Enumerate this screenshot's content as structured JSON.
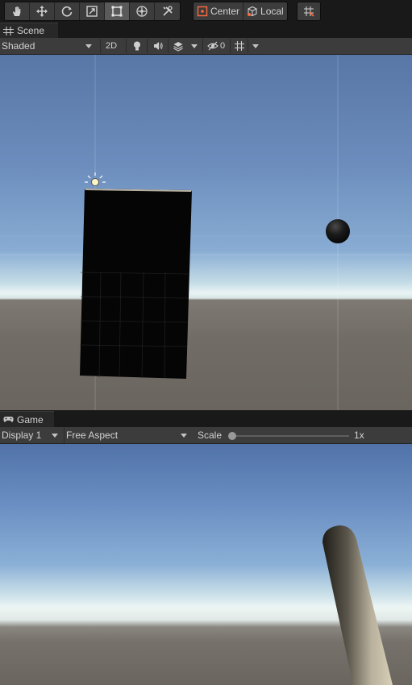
{
  "toolbar": {
    "tools": [
      {
        "name": "hand-tool",
        "icon": "hand-icon",
        "active": false
      },
      {
        "name": "move-tool",
        "icon": "move-icon",
        "active": false
      },
      {
        "name": "rotate-tool",
        "icon": "rotate-icon",
        "active": false
      },
      {
        "name": "scale-tool",
        "icon": "scale-icon",
        "active": false
      },
      {
        "name": "rect-tool",
        "icon": "rect-icon",
        "active": true
      },
      {
        "name": "transform-tool",
        "icon": "transform-icon",
        "active": false
      },
      {
        "name": "custom-tool",
        "icon": "tools-icon",
        "active": false
      }
    ],
    "pivot_label": "Center",
    "rotation_label": "Local",
    "snap_icon": "grid-snap-icon"
  },
  "scene": {
    "tab_label": "Scene",
    "draw_mode": "Shaded",
    "mode_2d_label": "2D",
    "hidden_count": "0"
  },
  "game": {
    "tab_label": "Game",
    "display": "Display 1",
    "aspect": "Free Aspect",
    "scale_label": "Scale",
    "scale_value": "1x",
    "scale_fraction": 0.0
  },
  "colors": {
    "panel": "#3c3c3c",
    "background": "#191919",
    "text": "#d2d2d2",
    "accent": "#ff6a3d"
  }
}
